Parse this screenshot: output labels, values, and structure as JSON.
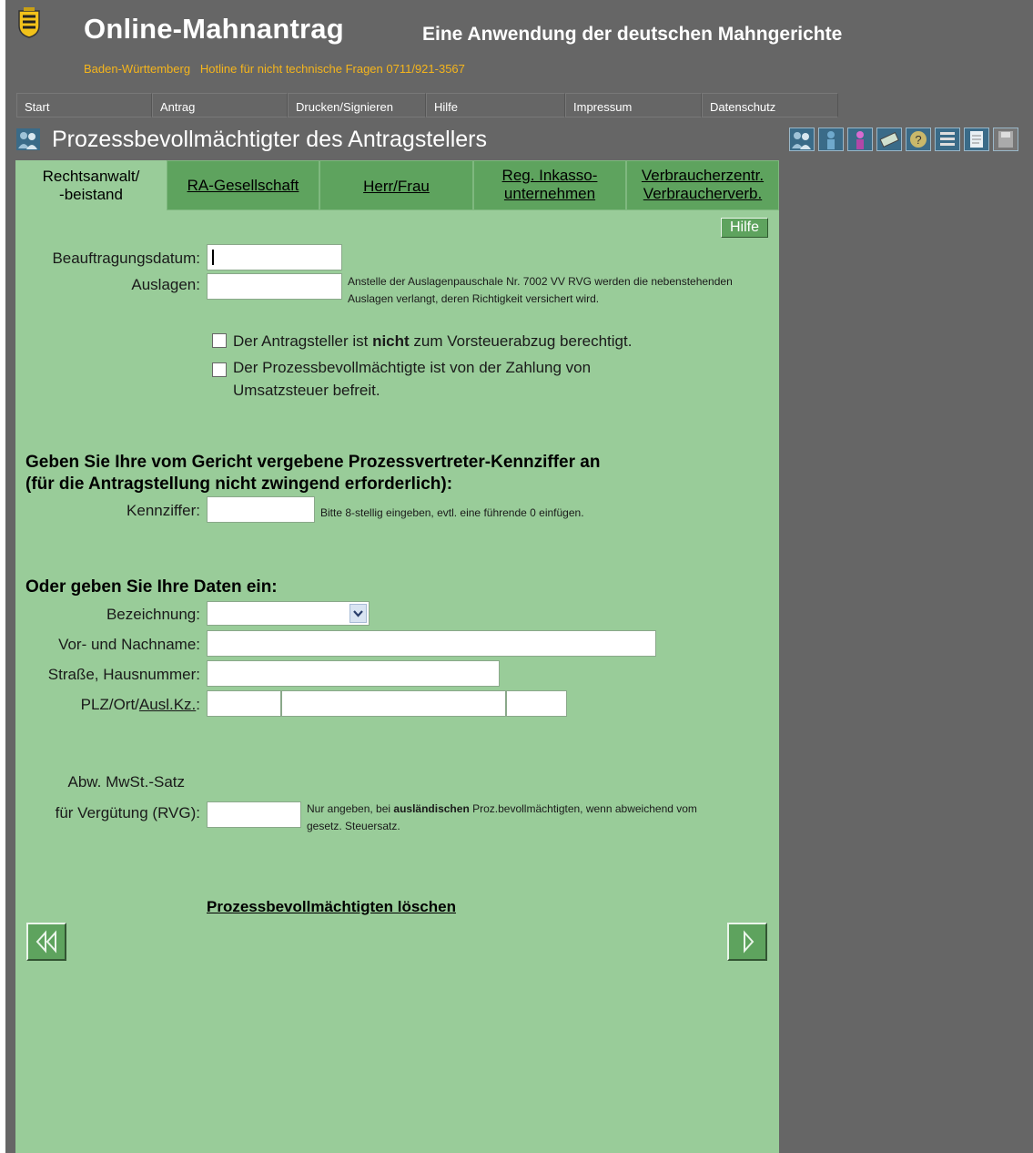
{
  "header": {
    "title": "Online-Mahnantrag",
    "subtitle": "Eine Anwendung der deutschen Mahngerichte",
    "hotline": "Baden-Württemberg   Hotline für nicht technische Fragen 0711/921-3567"
  },
  "nav": [
    {
      "label": "Start"
    },
    {
      "label": "Antrag"
    },
    {
      "label": "Drucken/Signieren"
    },
    {
      "label": "Hilfe"
    },
    {
      "label": "Impressum"
    },
    {
      "label": "Datenschutz"
    }
  ],
  "page_title": "Prozessbevollmächtigter des Antragstellers",
  "toolbar": {
    "icons": [
      "persons-icon",
      "person-icon",
      "person-purple-icon",
      "money-icon",
      "question-icon",
      "list-icon",
      "document-icon",
      "save-icon"
    ]
  },
  "tabs": [
    {
      "line1": "Rechtsanwalt/",
      "line2": "-beistand"
    },
    {
      "line1": "RA-Gesellschaft",
      "line2": ""
    },
    {
      "line1": "Herr/Frau",
      "line2": ""
    },
    {
      "line1": "Reg. Inkasso-",
      "line2": "unternehmen"
    },
    {
      "line1": "Verbraucherzentr.",
      "line2": "Verbraucherverb."
    }
  ],
  "help_label": "Hilfe",
  "form": {
    "beauftragungsdatum_label": "Beauftragungsdatum:",
    "auslagen_label": "Auslagen:",
    "auslagen_note": "Anstelle der Auslagenpauschale Nr. 7002 VV RVG werden die nebenstehenden Auslagen verlangt, deren Richtigkeit versichert wird.",
    "check1_pre": "Der Antragsteller ist ",
    "check1_bold": "nicht",
    "check1_post": " zum Vorsteuerabzug berechtigt.",
    "check2": "Der Prozessbevollmächtigte ist von der Zahlung von Umsatzsteuer befreit.",
    "section1_line1": "Geben Sie Ihre vom Gericht vergebene Prozessvertreter-Kennziffer an",
    "section1_line2": "(für die Antragstellung nicht zwingend erforderlich):",
    "kennziffer_label": "Kennziffer:",
    "kennziffer_note": "Bitte 8-stellig eingeben, evtl. eine führende 0 einfügen.",
    "section2": "Oder geben Sie Ihre Daten ein:",
    "bezeichnung_label": "Bezeichnung:",
    "name_label": "Vor- und Nachname:",
    "strasse_label": "Straße, Hausnummer:",
    "plz_label_pre": "PLZ/Ort/",
    "plz_label_link": "Ausl.Kz.",
    "plz_label_post": ":",
    "mwst_label1": "Abw. MwSt.-Satz",
    "mwst_label2": "für Vergütung (RVG):",
    "mwst_note_pre": "Nur angeben, bei ",
    "mwst_note_bold": "ausländischen",
    "mwst_note_post": " Proz.bevollmächtigten, wenn abweichend vom gesetz. Steuersatz.",
    "delete_link": "Prozessbevollmächtigten löschen"
  },
  "colors": {
    "frame": "#666666",
    "panel": "#99cc99",
    "tab_inactive": "#5ea35e",
    "hotline": "#f5b51c"
  }
}
